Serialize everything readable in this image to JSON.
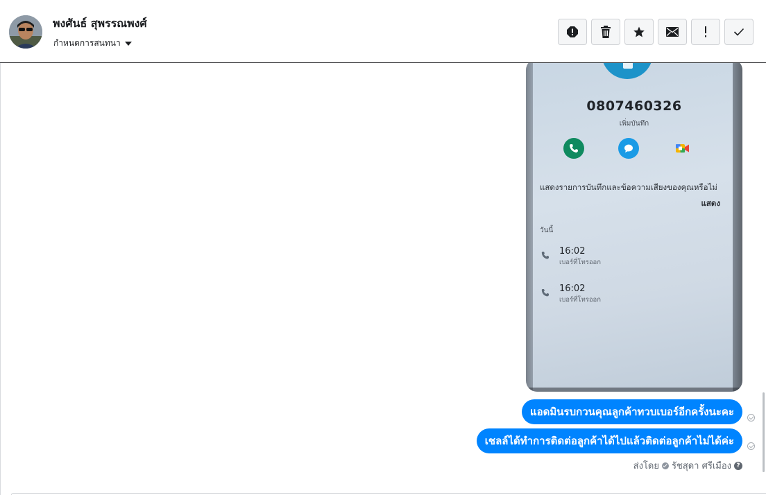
{
  "contact": {
    "name": "พงศันธ์ สุพรรณพงศ์",
    "assign_label": "กำหนดการสนทนา"
  },
  "toolbar": {
    "buttons": [
      {
        "name": "spam",
        "icon": "alert-circle-icon"
      },
      {
        "name": "delete",
        "icon": "trash-icon"
      },
      {
        "name": "star",
        "icon": "star-icon"
      },
      {
        "name": "mark-unread",
        "icon": "envelope-icon"
      },
      {
        "name": "follow-up",
        "icon": "exclamation-icon"
      },
      {
        "name": "mark-done",
        "icon": "checkmark-icon"
      }
    ]
  },
  "conversation": {
    "attachment": {
      "phone_number": "0807460326",
      "add_note": "เพิ่มบันทึก",
      "show_prompt": "แสดงรายการบันทึกและข้อความเสียงของคุณหรือไม่",
      "show_action": "แสดง",
      "section": "วันนี้",
      "call_log": [
        {
          "time": "16:02",
          "label": "เบอร์ที่โทรออก"
        },
        {
          "time": "16:02",
          "label": "เบอร์ที่โทรออก"
        }
      ]
    },
    "messages": [
      {
        "text": "แอดมินรบกวนคุณลูกค้าทวบเบอร์อีกครั้งนะคะ"
      },
      {
        "text": "เชลล์ได้ทำการติดต่อลูกค้าได้ไปแล้วติดต่อลูกค้าไม่ได้ค่ะ"
      }
    ],
    "sent_by_label": "ส่งโดย",
    "sent_by_name": "รัชสุดา ศรีเมือง"
  },
  "colors": {
    "bubble": "#0084ff",
    "call": "#0f8a5f",
    "message": "#1a9be6"
  }
}
